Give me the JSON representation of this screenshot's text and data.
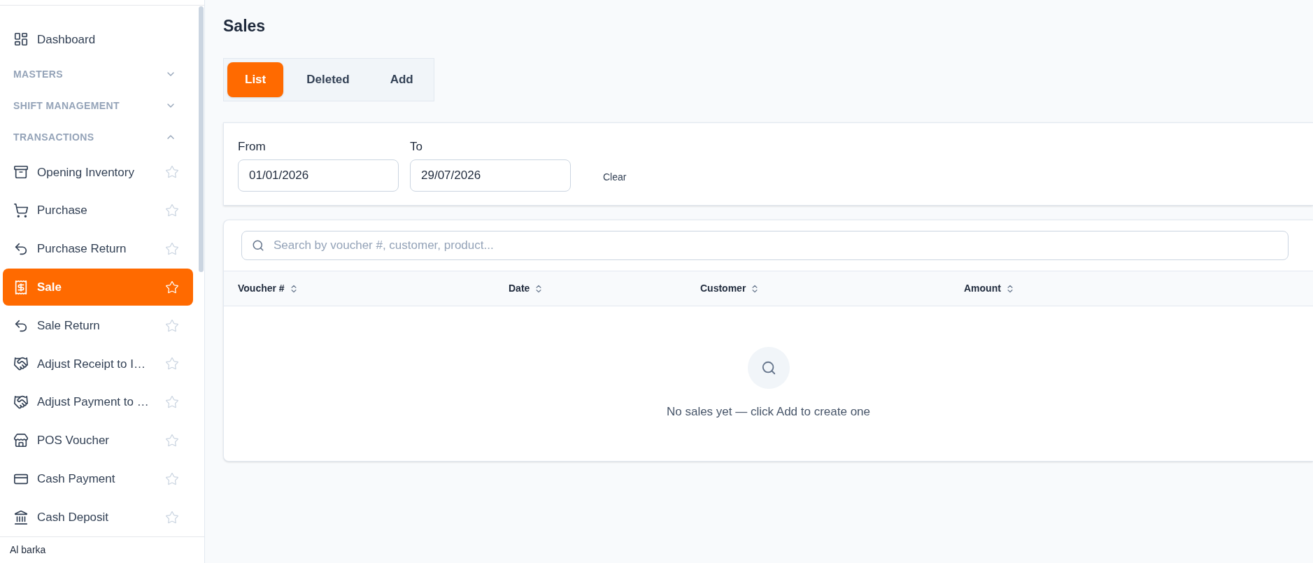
{
  "sidebar": {
    "items": [
      {
        "kind": "link",
        "label": "Dashboard"
      },
      {
        "kind": "section",
        "label": "MASTERS",
        "expanded": false
      },
      {
        "kind": "section",
        "label": "SHIFT MANAGEMENT",
        "expanded": false
      },
      {
        "kind": "section",
        "label": "TRANSACTIONS",
        "expanded": true
      },
      {
        "kind": "item",
        "label": "Opening Inventory",
        "selected": false
      },
      {
        "kind": "item",
        "label": "Purchase",
        "selected": false
      },
      {
        "kind": "item",
        "label": "Purchase Return",
        "selected": false
      },
      {
        "kind": "item",
        "label": "Sale",
        "selected": true
      },
      {
        "kind": "item",
        "label": "Sale Return",
        "selected": false
      },
      {
        "kind": "item",
        "label": "Adjust Receipt to I…",
        "selected": false
      },
      {
        "kind": "item",
        "label": "Adjust Payment to …",
        "selected": false
      },
      {
        "kind": "item",
        "label": "POS Voucher",
        "selected": false
      },
      {
        "kind": "item",
        "label": "Cash Payment",
        "selected": false
      },
      {
        "kind": "item",
        "label": "Cash Deposit",
        "selected": false
      }
    ],
    "footer": "Al barka"
  },
  "page": {
    "title": "Sales"
  },
  "tabs": [
    {
      "label": "List",
      "selected": true
    },
    {
      "label": "Deleted",
      "selected": false
    },
    {
      "label": "Add",
      "selected": false
    }
  ],
  "filters": {
    "from": {
      "label": "From",
      "value": "01/01/2026"
    },
    "to": {
      "label": "To",
      "value": "29/07/2026"
    },
    "clear": "Clear"
  },
  "search": {
    "placeholder": "Search by voucher #, customer, product..."
  },
  "table": {
    "columns": [
      "Voucher #",
      "Date",
      "Customer",
      "Amount"
    ],
    "empty_message": "No sales yet — click Add to create one"
  }
}
